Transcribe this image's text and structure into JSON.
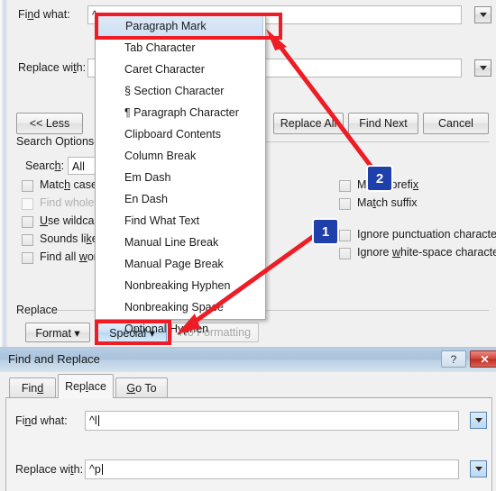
{
  "upper_dialog": {
    "find_what_label": "Find what:",
    "find_what_value": "^",
    "replace_with_label": "Replace with:",
    "replace_with_value": "",
    "less_button": "<< Less",
    "replace_all_button": "Replace All",
    "find_next_button": "Find Next",
    "cancel_button": "Cancel",
    "search_options_title": "Search Options",
    "search_label": "Search:",
    "search_value": "All",
    "left_checkboxes": [
      {
        "label": "Match case",
        "checked": false,
        "disabled": false
      },
      {
        "label": "Find whole w",
        "checked": false,
        "disabled": true
      },
      {
        "label": "Use wildcard",
        "checked": false,
        "disabled": false
      },
      {
        "label": "Sounds like (",
        "checked": false,
        "disabled": false
      },
      {
        "label": "Find all word",
        "checked": false,
        "disabled": false
      }
    ],
    "right_checkboxes": [
      {
        "label": "Match prefix",
        "checked": false,
        "disabled": false
      },
      {
        "label": "Match suffix",
        "checked": false,
        "disabled": false
      },
      {
        "label": "Ignore punctuation characters",
        "checked": false,
        "disabled": false
      },
      {
        "label": "Ignore white-space characters",
        "checked": false,
        "disabled": false
      }
    ],
    "replace_group_title": "Replace",
    "format_button": "Format ▾",
    "special_button": "Special ▾",
    "no_formatting_button": "No Formatting"
  },
  "special_menu": {
    "items": [
      {
        "label": "Paragraph Mark",
        "selected": true
      },
      {
        "label": "Tab Character",
        "selected": false
      },
      {
        "label": "Caret Character",
        "selected": false
      },
      {
        "label": "§ Section Character",
        "selected": false
      },
      {
        "label": "¶ Paragraph Character",
        "selected": false
      },
      {
        "label": "Clipboard Contents",
        "selected": false
      },
      {
        "label": "Column Break",
        "selected": false
      },
      {
        "label": "Em Dash",
        "selected": false
      },
      {
        "label": "En Dash",
        "selected": false
      },
      {
        "label": "Find What Text",
        "selected": false
      },
      {
        "label": "Manual Line Break",
        "selected": false
      },
      {
        "label": "Manual Page Break",
        "selected": false
      },
      {
        "label": "Nonbreaking Hyphen",
        "selected": false
      },
      {
        "label": "Nonbreaking Space",
        "selected": false
      },
      {
        "label": "Optional Hyphen",
        "selected": false
      }
    ]
  },
  "annotations": {
    "badge_one": "1",
    "badge_two": "2",
    "highlight_color": "#ee1c25",
    "badge_color": "#1f3faa"
  },
  "lower_dialog": {
    "title": "Find and Replace",
    "help_button": "?",
    "close_button": "✕",
    "tabs": [
      {
        "label": "Find",
        "active": false
      },
      {
        "label": "Replace",
        "active": true
      },
      {
        "label": "Go To",
        "active": false
      }
    ],
    "find_what_label": "Find what:",
    "find_what_value": "^l",
    "replace_with_label": "Replace with:",
    "replace_with_value": "^p"
  }
}
